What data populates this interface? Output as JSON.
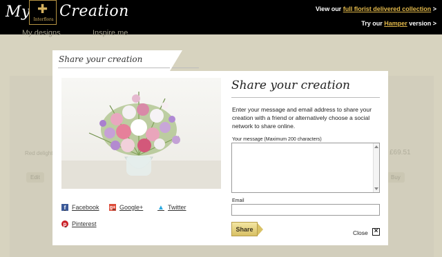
{
  "header": {
    "logo_my": "My",
    "logo_brand": "Interflora",
    "logo_creation": "Creation",
    "line1_prefix": "View our ",
    "line1_link": "full florist delivered collection",
    "line1_suffix": " >",
    "line2_prefix": "Try our ",
    "line2_link": "Hamper",
    "line2_suffix": " version >"
  },
  "background": {
    "tab1": "My designs",
    "tab2": "Inspire me",
    "item_name": "Red delight",
    "price": "£69.51",
    "edit_label": "Edit",
    "buy_label": "Buy"
  },
  "modal": {
    "tab_title": "Share your creation",
    "form_title": "Share your creation",
    "intro": "Enter your message and email address to share your creation with a friend or alternatively choose a social network to share online.",
    "message_label": "Your message (Maximum 200 characters)",
    "message_value": "",
    "email_label": "Email",
    "email_value": "",
    "share_label": "Share",
    "close_label": "Close",
    "social": {
      "facebook": "Facebook",
      "google": "Google+",
      "twitter": "Twitter",
      "pinterest": "Pinterest"
    }
  },
  "colors": {
    "header_bg": "#000000",
    "link_gold": "#e2b84a",
    "facebook": "#3b5998",
    "google": "#dd4b39",
    "twitter": "#29a9e1",
    "pinterest": "#cb2027"
  }
}
